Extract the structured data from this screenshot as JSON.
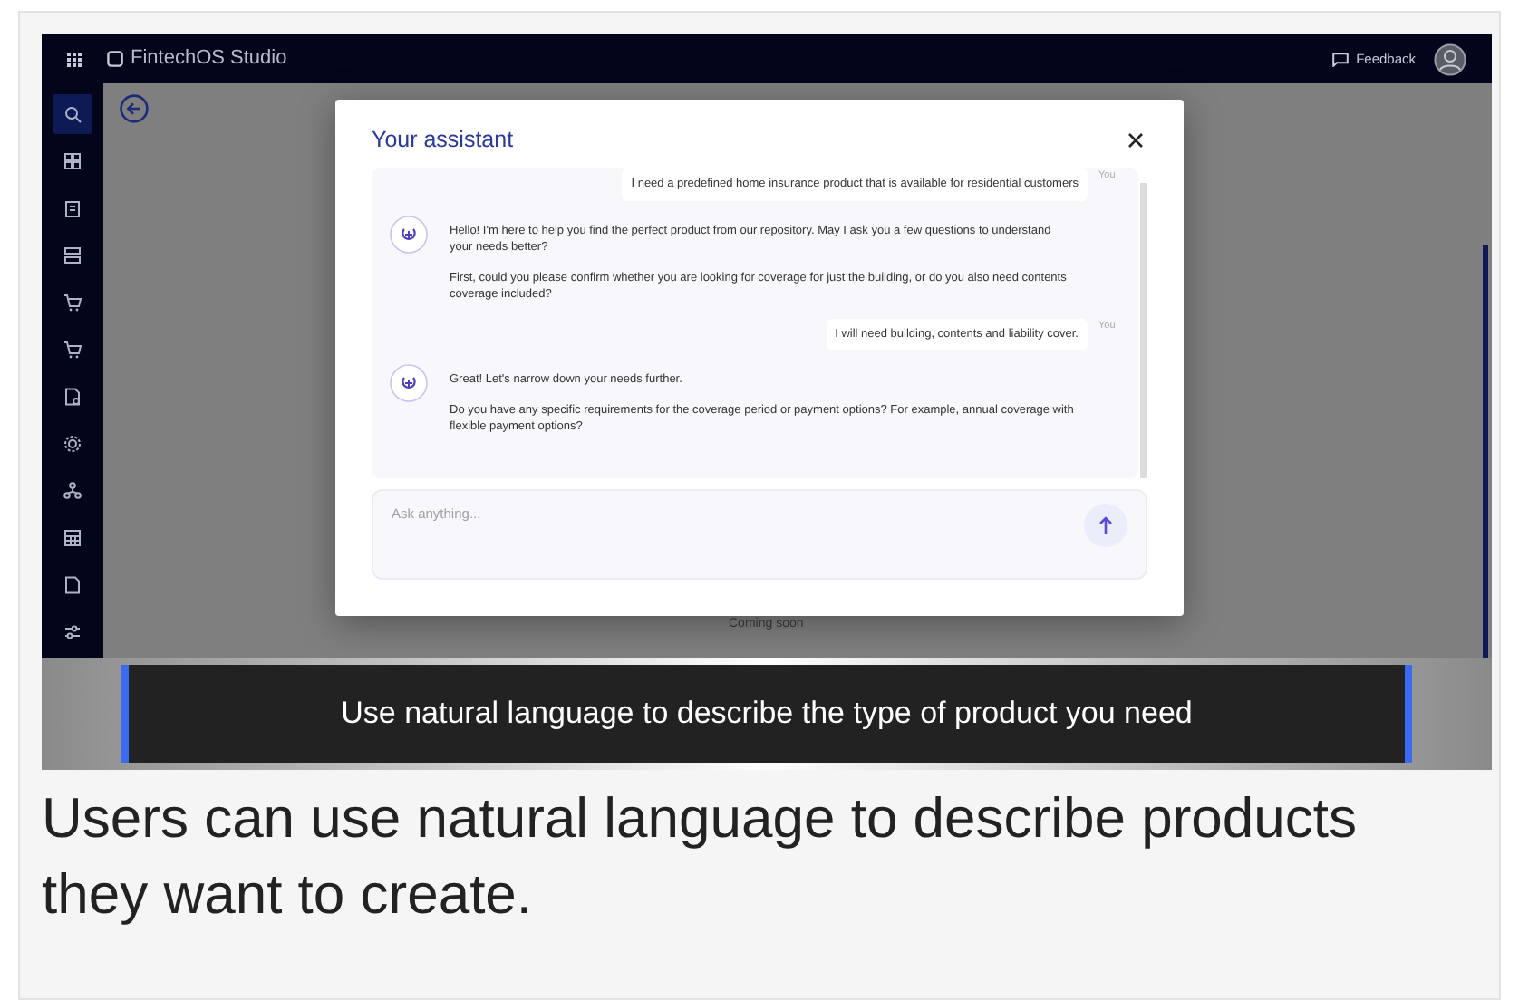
{
  "app": {
    "title": "FintechOS Studio",
    "feedback": "Feedback",
    "footer_note": "Coming soon"
  },
  "sidebar": {
    "items": [
      {
        "kind": "search",
        "selected": true
      },
      {
        "kind": "grid",
        "selected": false
      },
      {
        "kind": "clipboard",
        "selected": false
      },
      {
        "kind": "boxes",
        "selected": false
      },
      {
        "kind": "cart",
        "selected": false
      },
      {
        "kind": "cart",
        "selected": false
      },
      {
        "kind": "document",
        "selected": false
      },
      {
        "kind": "gear",
        "selected": false
      },
      {
        "kind": "network",
        "selected": false
      },
      {
        "kind": "table",
        "selected": false
      },
      {
        "kind": "file",
        "selected": false
      },
      {
        "kind": "sliders",
        "selected": false
      }
    ]
  },
  "dialog": {
    "title": "Your assistant",
    "messages": [
      {
        "kind": "user",
        "text": "I need a predefined home insurance product that is available for residential customers",
        "sender": "You"
      },
      {
        "kind": "assistant",
        "paragraphs": [
          "Hello! I'm here to help you find the perfect product from our repository. May I ask you a few questions to understand your needs better?",
          "First, could you please confirm whether you are looking for coverage for just the building, or do you also need contents coverage included?"
        ]
      },
      {
        "kind": "user",
        "text": "I will need building, contents and liability cover.",
        "sender": "You"
      },
      {
        "kind": "assistant",
        "paragraphs": [
          "Great! Let's narrow down your needs further.",
          "Do you have any specific requirements for the coverage period or payment options? For example, annual coverage with flexible payment options?"
        ]
      }
    ],
    "input": {
      "placeholder": "Ask anything..."
    }
  },
  "caption": "Use natural language to describe the type of product you need",
  "description": "Users can use natural language to describe products they want to create."
}
